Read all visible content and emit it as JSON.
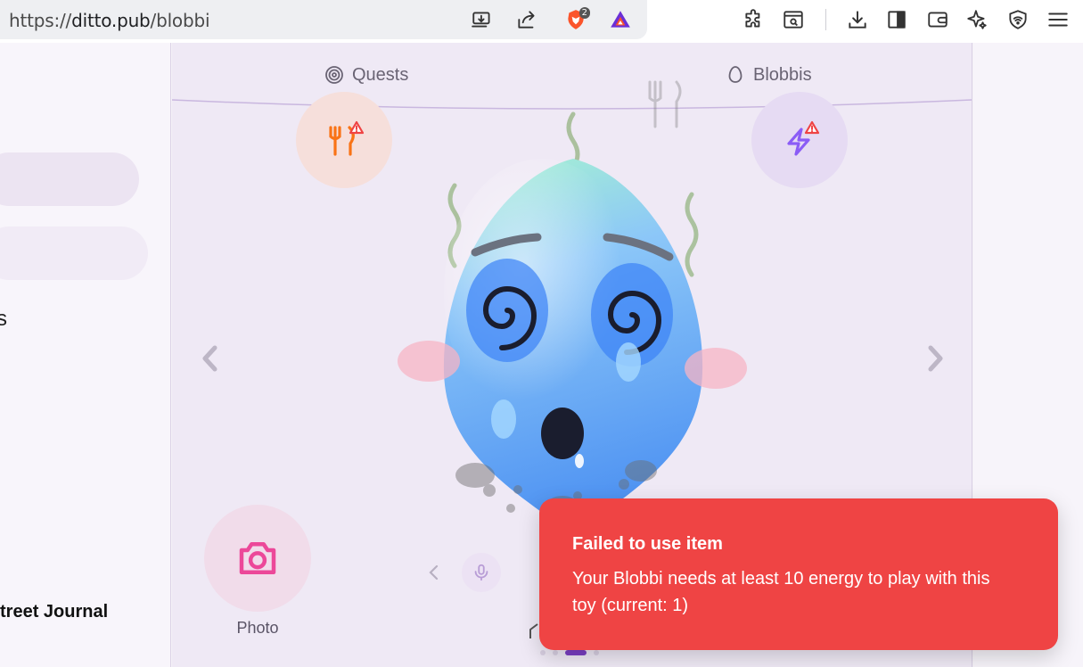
{
  "browser": {
    "url_scheme": "https://",
    "url_host": "ditto.pub",
    "url_path": "/blobbi",
    "brave_badge_count": "2",
    "icons": [
      "install-app-icon",
      "share-icon",
      "brave-shields-icon",
      "brave-rewards-icon",
      "extensions-icon",
      "reader-mode-icon",
      "downloads-icon",
      "sidebar-icon",
      "wallet-icon",
      "leo-ai-icon",
      "vpn-icon",
      "menu-icon"
    ]
  },
  "left_sidebar": {
    "fragment_s": "s",
    "fragment_journal": "treet Journal"
  },
  "tabs": {
    "quests": "Quests",
    "blobbis": "Blobbis"
  },
  "stats": {
    "food_icon": "fork-knife-icon",
    "energy_icon": "lightning-icon",
    "warning_icon": "warning-triangle-icon"
  },
  "actions": {
    "photo_label": "Photo"
  },
  "carousel": {
    "dot_count": 5,
    "active_dot": 3
  },
  "toast": {
    "title": "Failed to use item",
    "message": "Your Blobbi needs at least 10 energy to play with this toy (current: 1)"
  },
  "colors": {
    "toast_bg": "#ef4444",
    "accent_purple": "#7b3fc4",
    "food_orange": "#f97316",
    "energy_purple": "#8b5cf6",
    "photo_pink": "#ec4899",
    "blobbi_blue": "#5b9df5",
    "blobbi_mint": "#9ff0c9"
  }
}
